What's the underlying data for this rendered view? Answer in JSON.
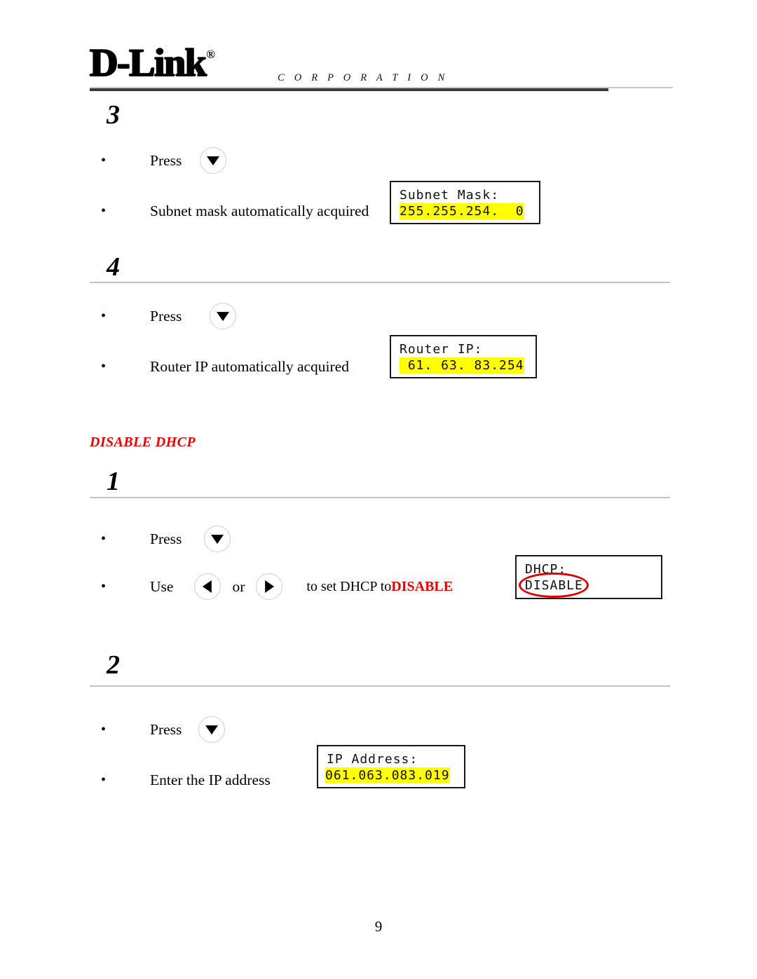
{
  "header": {
    "brand": "D-Link",
    "registered_mark": "®",
    "tagline": "C O R P O R A T I O N"
  },
  "sections": [
    {
      "step_number": "3",
      "bullets": [
        {
          "text": "Press",
          "key": "down-arrow"
        },
        {
          "text": "Subnet mask automatically acquired"
        }
      ],
      "display": {
        "label": "Subnet Mask:",
        "value": "255.255.254.  0"
      }
    },
    {
      "step_number": "4",
      "bullets": [
        {
          "text": "Press",
          "key": "down-arrow"
        },
        {
          "text": "Router IP automatically acquired"
        }
      ],
      "display": {
        "label": "Router IP:",
        "value": " 61. 63. 83.254"
      }
    }
  ],
  "disable_dhcp": {
    "heading": "DISABLE DHCP",
    "steps": [
      {
        "step_number": "1",
        "bullets": [
          {
            "text": "Press",
            "key": "down-arrow"
          },
          {
            "prefix": "Use",
            "middle": "or",
            "suffix_plain": "to set DHCP to ",
            "suffix_emphasis": "DISABLE",
            "keys": [
              "left-arrow",
              "right-arrow"
            ]
          }
        ],
        "display": {
          "label": "DHCP:",
          "value": "DISABLE",
          "annotation": "red-ellipse"
        }
      },
      {
        "step_number": "2",
        "bullets": [
          {
            "text": "Press",
            "key": "down-arrow"
          },
          {
            "text": "Enter the IP address"
          }
        ],
        "display": {
          "label": "IP Address:",
          "value": "061.063.083.019"
        }
      }
    ]
  },
  "footer": {
    "page_number": "9"
  },
  "colors": {
    "accent_red": "#ee0000",
    "highlight_yellow": "#ffff00",
    "rule_gray": "#c0c0c0"
  }
}
